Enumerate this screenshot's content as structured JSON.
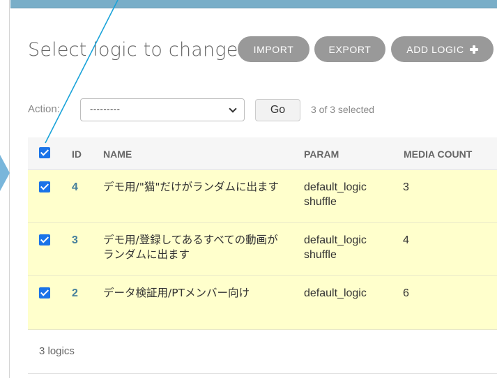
{
  "page": {
    "title": "Select logic to change"
  },
  "object_tools": {
    "import_label": "IMPORT",
    "export_label": "EXPORT",
    "add_label": "ADD LOGIC"
  },
  "actions": {
    "label": "Action:",
    "selected_value": "---------",
    "go_label": "Go",
    "selection_count": "3 of 3 selected"
  },
  "table": {
    "columns": [
      "ID",
      "NAME",
      "PARAM",
      "MEDIA COUNT"
    ],
    "rows": [
      {
        "id": "4",
        "name": "デモ用/\"猫\"だけがランダムに出ます",
        "param": "default_logic shuffle",
        "media_count": "3",
        "checked": true
      },
      {
        "id": "3",
        "name": "デモ用/登録してあるすべての動画がランダムに出ます",
        "param": "default_logic shuffle",
        "media_count": "4",
        "checked": true
      },
      {
        "id": "2",
        "name": "データ検証用/PTメンバー向け",
        "param": "default_logic",
        "media_count": "6",
        "checked": true
      }
    ]
  },
  "paginator": {
    "text": "3 logics"
  },
  "colors": {
    "header_bar": "#79aec8",
    "selected_row": "#ffffcc",
    "link": "#447e9b",
    "pill_button": "#999999",
    "checkbox": "#1a73e8",
    "annotation_line": "#1aa3d9"
  }
}
